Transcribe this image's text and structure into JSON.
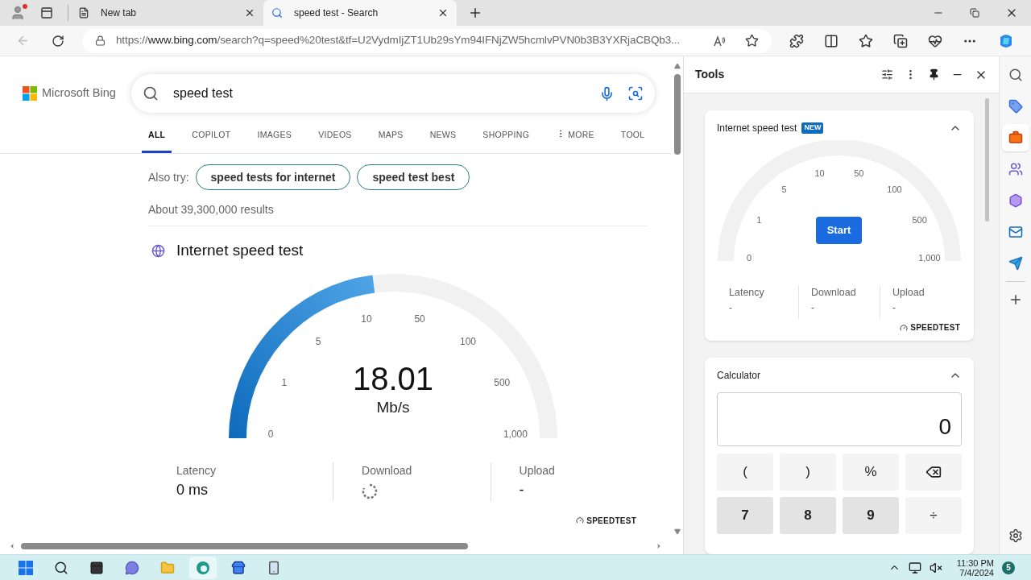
{
  "browser": {
    "tabs": [
      {
        "title": "New tab",
        "selected": false
      },
      {
        "title": "speed test - Search",
        "selected": true
      }
    ],
    "address": {
      "scheme": "https://",
      "host": "www.bing.com",
      "rest": "/search?q=speed%20test&tf=U2VydmIjZT1Ub29sYm94IFNjZW5hcmlvPVN0b3B3YXRjaCBQb3..."
    }
  },
  "page": {
    "logo": "Microsoft Bing",
    "search": {
      "value": "speed test"
    },
    "nav": [
      {
        "label": "ALL",
        "selected": true
      },
      {
        "label": "COPILOT",
        "selected": false
      },
      {
        "label": "IMAGES",
        "selected": false
      },
      {
        "label": "VIDEOS",
        "selected": false
      },
      {
        "label": "MAPS",
        "selected": false
      },
      {
        "label": "NEWS",
        "selected": false
      },
      {
        "label": "SHOPPING",
        "selected": false
      },
      {
        "label": "MORE",
        "selected": false,
        "kind": "menu"
      },
      {
        "label": "TOOL",
        "selected": false
      }
    ],
    "also_try": {
      "label": "Also try:",
      "chips": [
        "speed tests for internet",
        "speed test best"
      ]
    },
    "results_count": "About 39,300,000 results",
    "speed_test": {
      "title": "Internet speed test",
      "gauge": {
        "level": 0.46,
        "ticks": [
          "0",
          "1",
          "5",
          "10",
          "50",
          "100",
          "500",
          "1,000"
        ],
        "reading": "18.01",
        "unit": "Mb/s"
      },
      "stats": [
        {
          "label": "Latency",
          "kind": "text",
          "value": "0 ms"
        },
        {
          "label": "Download",
          "kind": "spinner"
        },
        {
          "label": "Upload",
          "kind": "text",
          "value": "-"
        }
      ],
      "brand": "SPEEDTEST"
    }
  },
  "tools": {
    "title": "Tools",
    "speed_test": {
      "title": "Internet speed test",
      "badge": "NEW",
      "expanded": true,
      "ticks": [
        "0",
        "1",
        "5",
        "10",
        "50",
        "100",
        "500",
        "1,000"
      ],
      "button": "Start",
      "stats": [
        {
          "label": "Latency",
          "value": "-"
        },
        {
          "label": "Download",
          "value": "-"
        },
        {
          "label": "Upload",
          "value": "-"
        }
      ],
      "brand": "SPEEDTEST"
    },
    "calculator": {
      "title": "Calculator",
      "expanded": true,
      "display": "0",
      "keys": [
        {
          "kind": "op",
          "label": "("
        },
        {
          "kind": "op",
          "label": ")"
        },
        {
          "kind": "op",
          "label": "%"
        },
        {
          "kind": "backspace"
        },
        {
          "kind": "digit",
          "label": "7"
        },
        {
          "kind": "digit",
          "label": "8"
        },
        {
          "kind": "digit",
          "label": "9"
        },
        {
          "kind": "op",
          "label": "÷"
        }
      ]
    }
  },
  "taskbar": {
    "time": "11:30 PM",
    "date": "7/4/2024",
    "notifications": "5"
  }
}
